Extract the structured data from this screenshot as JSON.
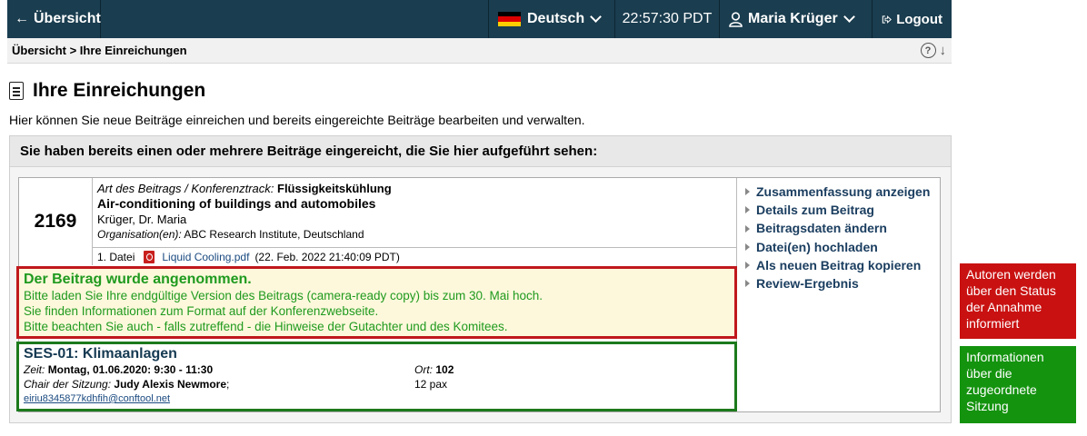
{
  "topbar": {
    "back_label": "Übersicht",
    "language": "Deutsch",
    "time": "22:57:30 PDT",
    "user": "Maria Krüger",
    "logout": "Logout"
  },
  "breadcrumb": {
    "text": "Übersicht > Ihre Einreichungen",
    "help": "?",
    "down": "↓"
  },
  "page": {
    "title": "Ihre Einreichungen",
    "intro": "Hier können Sie neue Beiträge einreichen und bereits eingereichte Beiträge bearbeiten und verwalten.",
    "box_header": "Sie haben bereits einen oder mehrere Beiträge eingereicht, die Sie hier aufgeführt sehen:"
  },
  "submission": {
    "number": "2169",
    "track_label": "Art des Beitrags / Konferenztrack:",
    "track": "Flüssigkeitskühlung",
    "title": "Air-conditioning of buildings and automobiles",
    "authors": "Krüger, Dr. Maria",
    "org_label": "Organisation(en):",
    "org": "ABC Research Institute, Deutschland",
    "file_label": "1. Datei",
    "file_name": "Liquid Cooling.pdf",
    "file_date": "(22. Feb. 2022 21:40:09 PDT)"
  },
  "actions": [
    "Zusammenfassung anzeigen",
    "Details zum Beitrag",
    "Beitragsdaten ändern",
    "Datei(en) hochladen",
    "Als neuen Beitrag kopieren",
    "Review-Ergebnis"
  ],
  "accepted": {
    "head": "Der Beitrag wurde angenommen.",
    "line1": "Bitte laden Sie Ihre endgültige Version des Beitrags (camera-ready copy) bis zum 30. Mai hoch.",
    "line2": "Sie finden Informationen zum Format auf der Konferenzwebseite.",
    "line3": "Bitte beachten Sie auch - falls zutreffend - die Hinweise der Gutachter und des Komitees."
  },
  "session": {
    "head": "SES-01: Klimaanlagen",
    "time_label": "Zeit:",
    "time": "Montag, 01.06.2020: 9:30 - 11:30",
    "place_label": "Ort:",
    "place": "102",
    "chair_label": "Chair der Sitzung:",
    "chair": "Judy Alexis Newmore",
    "chair_suffix": ";",
    "capacity": "12 pax",
    "email": "eiriu8345877kdhfih@conftool.net"
  },
  "notes": {
    "red": "Autoren werden über den Status der Annahme informiert",
    "green": "Informationen über die zugeordnete Sitzung"
  },
  "colors": {
    "topbar": "#1a3d4f",
    "note_red": "#c91111",
    "note_green": "#14930f",
    "accepted_text": "#1f9a1f"
  }
}
